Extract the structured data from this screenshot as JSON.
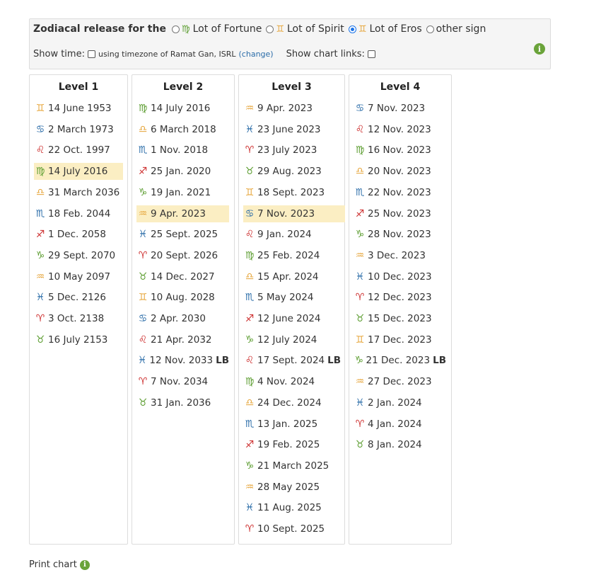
{
  "header": {
    "title": "Zodiacal release for the",
    "options": [
      {
        "label": "Lot of Fortune",
        "glyph": "♍",
        "color": "#5a9c2e",
        "checked": false
      },
      {
        "label": "Lot of Spirit",
        "glyph": "♊",
        "color": "#e6a53a",
        "checked": false
      },
      {
        "label": "Lot of Eros",
        "glyph": "♊",
        "color": "#e6a53a",
        "checked": true
      },
      {
        "label": "other sign",
        "glyph": "",
        "color": "",
        "checked": false
      }
    ],
    "show_time_label": "Show time:",
    "timezone_text": "using timezone of Ramat Gan, ISRL",
    "change_link": "(change)",
    "show_chart_links_label": "Show chart links:",
    "info_icon": "info-icon"
  },
  "signs": {
    "Gemini": {
      "glyph": "♊",
      "color": "#e6a53a"
    },
    "Cancer": {
      "glyph": "♋",
      "color": "#2a6ca8"
    },
    "Leo": {
      "glyph": "♌",
      "color": "#cc2b2b"
    },
    "Virgo": {
      "glyph": "♍",
      "color": "#5a9c2e"
    },
    "Libra": {
      "glyph": "♎",
      "color": "#e6a53a"
    },
    "Scorpio": {
      "glyph": "♏",
      "color": "#2a6ca8"
    },
    "Sagittarius": {
      "glyph": "♐",
      "color": "#cc2b2b"
    },
    "Capricorn": {
      "glyph": "♑",
      "color": "#5a9c2e"
    },
    "Aquarius": {
      "glyph": "♒",
      "color": "#e6a53a"
    },
    "Pisces": {
      "glyph": "♓",
      "color": "#2a6ca8"
    },
    "Aries": {
      "glyph": "♈",
      "color": "#cc2b2b"
    },
    "Taurus": {
      "glyph": "♉",
      "color": "#5a9c2e"
    }
  },
  "levels": [
    {
      "title": "Level 1",
      "entries": [
        {
          "sign": "Gemini",
          "date": "14 June 1953"
        },
        {
          "sign": "Cancer",
          "date": "2 March 1973"
        },
        {
          "sign": "Leo",
          "date": "22 Oct. 1997"
        },
        {
          "sign": "Virgo",
          "date": "14 July 2016",
          "current": true
        },
        {
          "sign": "Libra",
          "date": "31 March 2036"
        },
        {
          "sign": "Scorpio",
          "date": "18 Feb. 2044"
        },
        {
          "sign": "Sagittarius",
          "date": "1 Dec. 2058"
        },
        {
          "sign": "Capricorn",
          "date": "29 Sept. 2070"
        },
        {
          "sign": "Aquarius",
          "date": "10 May 2097"
        },
        {
          "sign": "Pisces",
          "date": "5 Dec. 2126"
        },
        {
          "sign": "Aries",
          "date": "3 Oct. 2138"
        },
        {
          "sign": "Taurus",
          "date": "16 July 2153"
        }
      ]
    },
    {
      "title": "Level 2",
      "entries": [
        {
          "sign": "Virgo",
          "date": "14 July 2016"
        },
        {
          "sign": "Libra",
          "date": "6 March 2018"
        },
        {
          "sign": "Scorpio",
          "date": "1 Nov. 2018"
        },
        {
          "sign": "Sagittarius",
          "date": "25 Jan. 2020"
        },
        {
          "sign": "Capricorn",
          "date": "19 Jan. 2021"
        },
        {
          "sign": "Aquarius",
          "date": "9 Apr. 2023",
          "current": true
        },
        {
          "sign": "Pisces",
          "date": "25 Sept. 2025"
        },
        {
          "sign": "Aries",
          "date": "20 Sept. 2026"
        },
        {
          "sign": "Taurus",
          "date": "14 Dec. 2027"
        },
        {
          "sign": "Gemini",
          "date": "10 Aug. 2028"
        },
        {
          "sign": "Cancer",
          "date": "2 Apr. 2030"
        },
        {
          "sign": "Leo",
          "date": "21 Apr. 2032"
        },
        {
          "sign": "Pisces",
          "date": "12 Nov. 2033",
          "lb": "LB"
        },
        {
          "sign": "Aries",
          "date": "7 Nov. 2034"
        },
        {
          "sign": "Taurus",
          "date": "31 Jan. 2036"
        }
      ]
    },
    {
      "title": "Level 3",
      "entries": [
        {
          "sign": "Aquarius",
          "date": "9 Apr. 2023"
        },
        {
          "sign": "Pisces",
          "date": "23 June 2023"
        },
        {
          "sign": "Aries",
          "date": "23 July 2023"
        },
        {
          "sign": "Taurus",
          "date": "29 Aug. 2023"
        },
        {
          "sign": "Gemini",
          "date": "18 Sept. 2023"
        },
        {
          "sign": "Cancer",
          "date": "7 Nov. 2023",
          "current": true
        },
        {
          "sign": "Leo",
          "date": "9 Jan. 2024"
        },
        {
          "sign": "Virgo",
          "date": "25 Feb. 2024"
        },
        {
          "sign": "Libra",
          "date": "15 Apr. 2024"
        },
        {
          "sign": "Scorpio",
          "date": "5 May 2024"
        },
        {
          "sign": "Sagittarius",
          "date": "12 June 2024"
        },
        {
          "sign": "Capricorn",
          "date": "12 July 2024"
        },
        {
          "sign": "Leo",
          "date": "17 Sept. 2024",
          "lb": "LB"
        },
        {
          "sign": "Virgo",
          "date": "4 Nov. 2024"
        },
        {
          "sign": "Libra",
          "date": "24 Dec. 2024"
        },
        {
          "sign": "Scorpio",
          "date": "13 Jan. 2025"
        },
        {
          "sign": "Sagittarius",
          "date": "19 Feb. 2025"
        },
        {
          "sign": "Capricorn",
          "date": "21 March 2025"
        },
        {
          "sign": "Aquarius",
          "date": "28 May 2025"
        },
        {
          "sign": "Pisces",
          "date": "11 Aug. 2025"
        },
        {
          "sign": "Aries",
          "date": "10 Sept. 2025"
        }
      ]
    },
    {
      "title": "Level 4",
      "entries": [
        {
          "sign": "Cancer",
          "date": "7 Nov. 2023"
        },
        {
          "sign": "Leo",
          "date": "12 Nov. 2023"
        },
        {
          "sign": "Virgo",
          "date": "16 Nov. 2023"
        },
        {
          "sign": "Libra",
          "date": "20 Nov. 2023"
        },
        {
          "sign": "Scorpio",
          "date": "22 Nov. 2023"
        },
        {
          "sign": "Sagittarius",
          "date": "25 Nov. 2023"
        },
        {
          "sign": "Capricorn",
          "date": "28 Nov. 2023"
        },
        {
          "sign": "Aquarius",
          "date": "3 Dec. 2023"
        },
        {
          "sign": "Pisces",
          "date": "10 Dec. 2023"
        },
        {
          "sign": "Aries",
          "date": "12 Dec. 2023"
        },
        {
          "sign": "Taurus",
          "date": "15 Dec. 2023"
        },
        {
          "sign": "Gemini",
          "date": "17 Dec. 2023"
        },
        {
          "sign": "Capricorn",
          "date": "21 Dec. 2023",
          "lb": "LB"
        },
        {
          "sign": "Aquarius",
          "date": "27 Dec. 2023"
        },
        {
          "sign": "Pisces",
          "date": "2 Jan. 2024"
        },
        {
          "sign": "Aries",
          "date": "4 Jan. 2024"
        },
        {
          "sign": "Taurus",
          "date": "8 Jan. 2024"
        }
      ]
    }
  ],
  "footer": {
    "print_label": "Print chart",
    "info_icon": "info-icon"
  }
}
